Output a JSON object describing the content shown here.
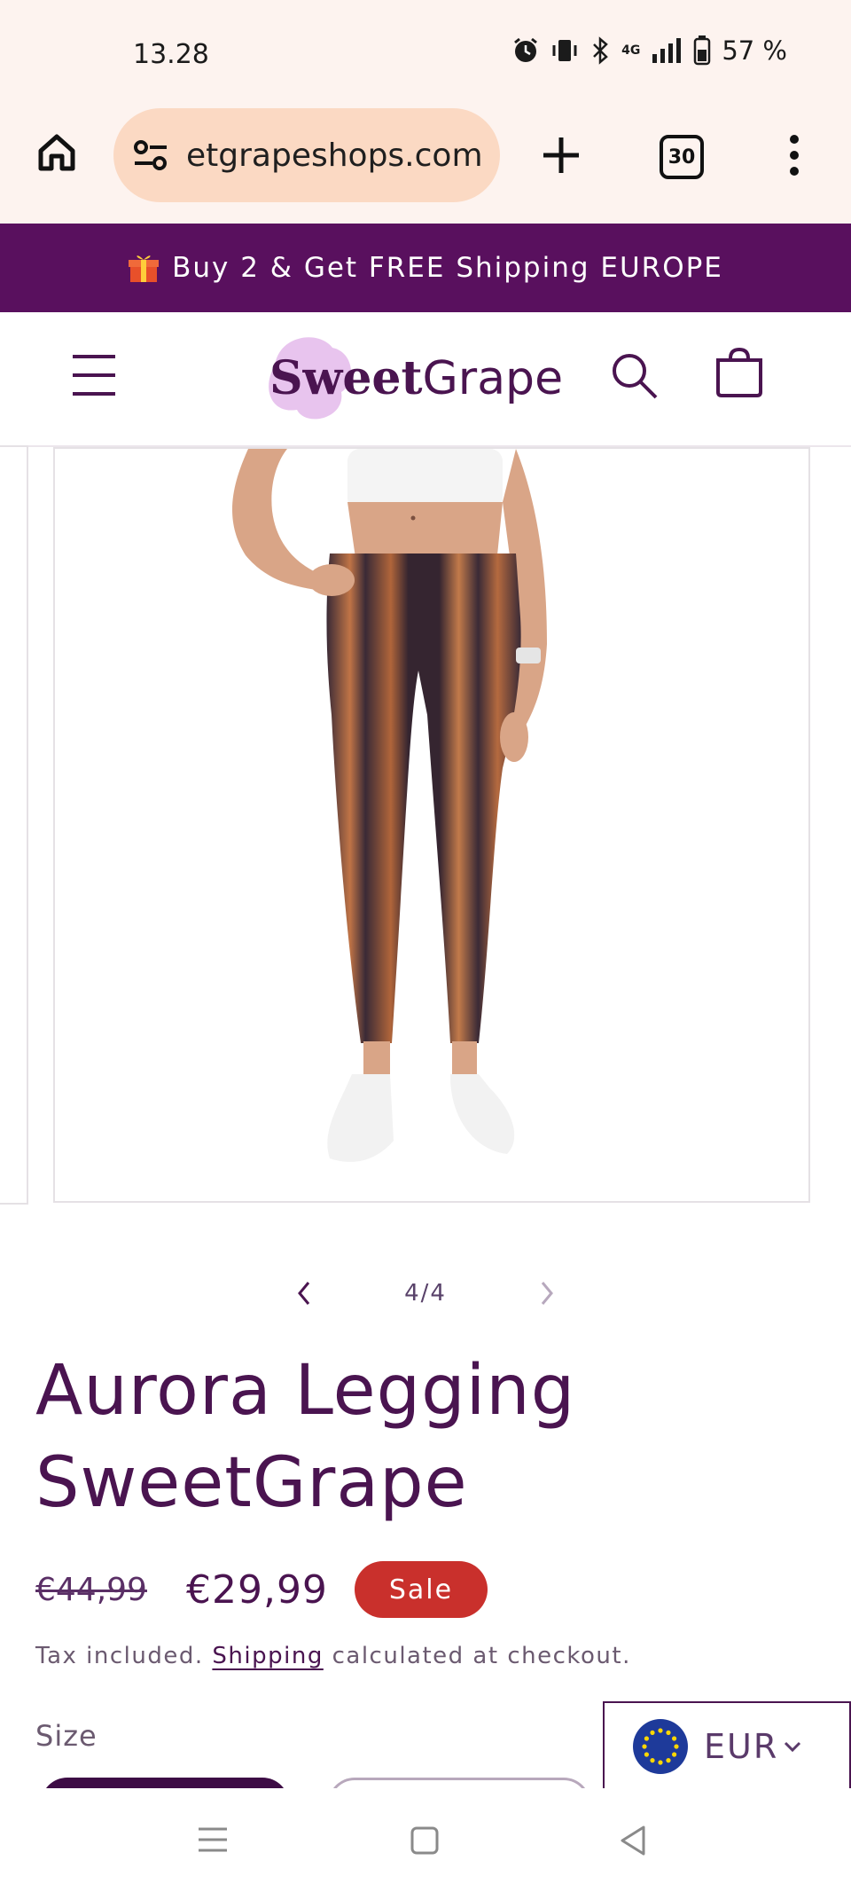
{
  "status_bar": {
    "time": "13.28",
    "network": "4G",
    "battery": "57 %"
  },
  "browser": {
    "url": "etgrapeshops.com",
    "tab_count": "30"
  },
  "promo": {
    "icon": "gift-icon",
    "text": "Buy 2 & Get FREE Shipping EUROPE"
  },
  "header": {
    "logo_bold": "Sweet",
    "logo_light": "Grape",
    "colors": {
      "brand": "#59105e",
      "logo_blob": "#e8c4ee"
    }
  },
  "gallery": {
    "pager": "4/4",
    "current": 4,
    "total": 4
  },
  "product": {
    "title_line1": "Aurora Legging",
    "title_line2": "SweetGrape",
    "price_old": "€44,99",
    "price_new": "€29,99",
    "sale_badge": "Sale",
    "tax_prefix": "Tax included.",
    "tax_link": "Shipping",
    "tax_suffix": "calculated at checkout.",
    "size_label": "Size"
  },
  "currency": {
    "code": "EUR"
  },
  "colors": {
    "accent": "#4a1450",
    "sale": "#c9302c"
  }
}
